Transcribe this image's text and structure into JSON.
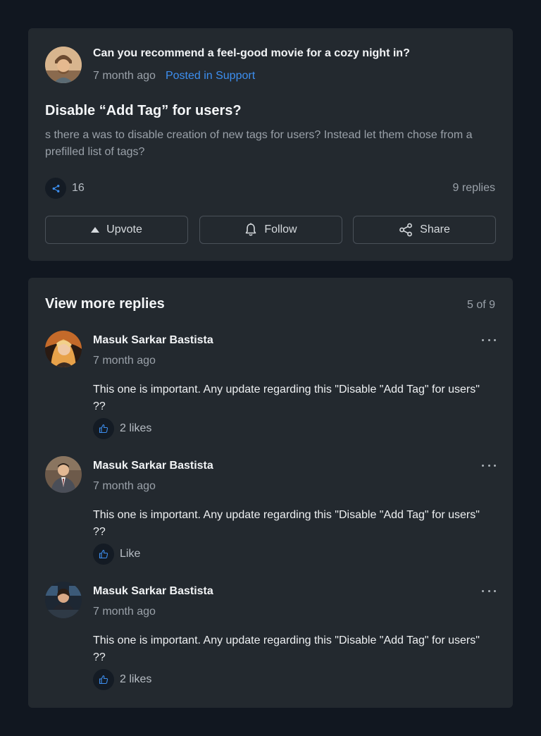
{
  "post": {
    "question": "Can you recommend a feel-good movie for a cozy night in?",
    "time": "7 month ago",
    "category": "Posted in Support",
    "title": "Disable “Add Tag” for users?",
    "body": "s there a was to disable creation of new tags for users? Instead let them chose from a prefilled list of tags?",
    "share_count": "16",
    "replies_count": "9 replies",
    "actions": {
      "upvote": "Upvote",
      "follow": "Follow",
      "share": "Share"
    },
    "icons": {
      "share": "share-icon",
      "upvote": "triangle-up-icon",
      "follow": "bell-icon"
    }
  },
  "replies": {
    "heading": "View more replies",
    "pagination": "5 of 9",
    "items": [
      {
        "author": "Masuk Sarkar Bastista",
        "time": "7 month ago",
        "text": "This one is important. Any update regarding this \"Disable \"Add Tag\" for users\" ??",
        "like_label": "2 likes"
      },
      {
        "author": "Masuk Sarkar Bastista",
        "time": "7 month ago",
        "text": "This one is important. Any update regarding this \"Disable \"Add Tag\" for users\" ??",
        "like_label": "Like"
      },
      {
        "author": "Masuk Sarkar Bastista",
        "time": "7 month ago",
        "text": "This one is important. Any update regarding this \"Disable \"Add Tag\" for users\" ??",
        "like_label": "2 likes"
      }
    ]
  },
  "colors": {
    "background": "#111720",
    "card": "#23292f",
    "accent": "#3d8ff0",
    "muted_text": "#9aa1a9"
  }
}
